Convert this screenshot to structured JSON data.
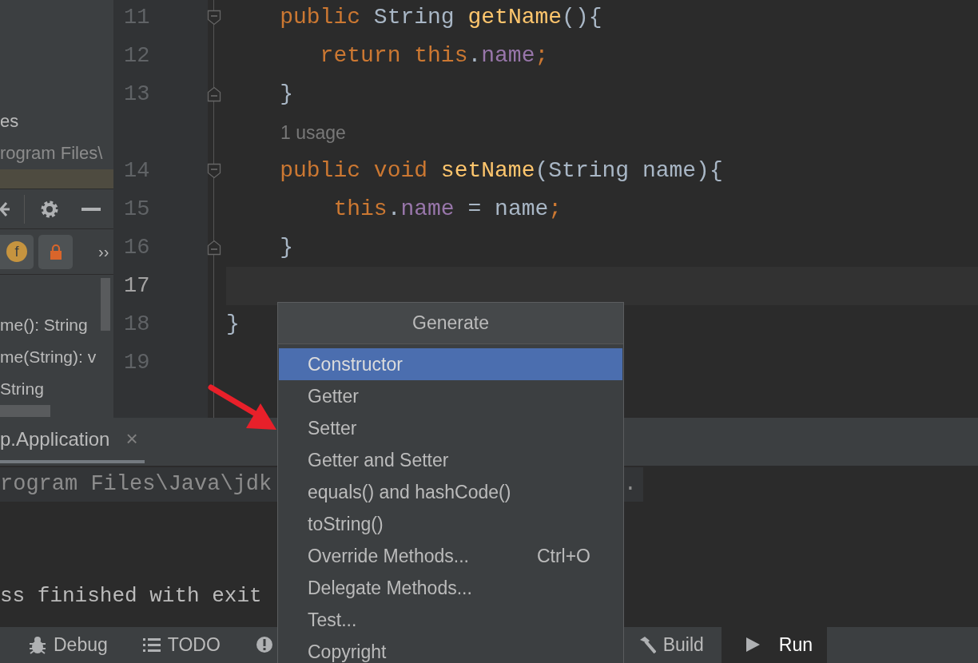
{
  "project_panel": {
    "items": [
      {
        "label": "es",
        "kind": "node",
        "selected": false
      },
      {
        "label": "rogram Files\\",
        "kind": "path",
        "selected": false
      },
      {
        "kind": "node",
        "selected": true
      }
    ]
  },
  "structure_panel": {
    "filters": [
      {
        "badge": "f",
        "kind": "field",
        "selected": true
      },
      {
        "kind": "lock",
        "selected": true
      }
    ],
    "more": "››",
    "items": [
      {
        "label": "me(): String"
      },
      {
        "label": "me(String): v"
      },
      {
        "label": "String"
      }
    ]
  },
  "editor": {
    "lines": [
      {
        "number": "11",
        "fold_start": true,
        "fold_end": false,
        "current": false,
        "tokens": [
          {
            "kind": "keyword",
            "text": "    public "
          },
          {
            "kind": "plain",
            "text": "String "
          },
          {
            "kind": "method",
            "text": "getName"
          },
          {
            "kind": "plain",
            "text": "(){"
          }
        ]
      },
      {
        "number": "12",
        "fold_start": false,
        "fold_end": false,
        "current": false,
        "tokens": [
          {
            "kind": "keyword",
            "text": "       return this"
          },
          {
            "kind": "plain",
            "text": "."
          },
          {
            "kind": "field",
            "text": "name"
          },
          {
            "kind": "keyword",
            "text": ";"
          }
        ]
      },
      {
        "number": "13",
        "fold_start": false,
        "fold_end": true,
        "current": false,
        "tokens": [
          {
            "kind": "plain",
            "text": "    }"
          }
        ]
      },
      {
        "kind": "hint",
        "text": "1 usage"
      },
      {
        "number": "14",
        "fold_start": true,
        "fold_end": false,
        "current": false,
        "tokens": [
          {
            "kind": "keyword",
            "text": "    public void "
          },
          {
            "kind": "method",
            "text": "setName"
          },
          {
            "kind": "plain",
            "text": "(String name){"
          }
        ]
      },
      {
        "number": "15",
        "fold_start": false,
        "fold_end": false,
        "current": false,
        "tokens": [
          {
            "kind": "keyword",
            "text": "        this"
          },
          {
            "kind": "plain",
            "text": "."
          },
          {
            "kind": "field",
            "text": "name"
          },
          {
            "kind": "plain",
            "text": " = name"
          },
          {
            "kind": "keyword",
            "text": ";"
          }
        ]
      },
      {
        "number": "16",
        "fold_start": false,
        "fold_end": true,
        "current": false,
        "tokens": [
          {
            "kind": "plain",
            "text": "    }"
          }
        ]
      },
      {
        "number": "17",
        "fold_start": false,
        "fold_end": false,
        "current": true
      },
      {
        "number": "18",
        "fold_start": false,
        "fold_end": false,
        "current": false,
        "tokens": [
          {
            "kind": "plain",
            "text": "}"
          }
        ]
      },
      {
        "number": "19",
        "fold_start": false,
        "fold_end": false,
        "current": false
      }
    ]
  },
  "run_panel": {
    "tab": {
      "label": "p.Application",
      "selected": true,
      "close": "×"
    },
    "console": [
      {
        "kind": "command",
        "text": "rogram Files\\Java\\jdk",
        "tail": "."
      },
      {
        "kind": "output",
        "text": "ss finished with exit"
      }
    ]
  },
  "tool_bar": [
    {
      "kind": "debug",
      "label": "Debug",
      "selected": false
    },
    {
      "kind": "todo",
      "label": "TODO",
      "selected": false
    },
    {
      "kind": "problems",
      "selected": false
    },
    {
      "kind": "build",
      "label": "Build",
      "selected": false
    },
    {
      "kind": "run",
      "label": "Run",
      "selected": true
    }
  ],
  "popup": {
    "title": "Generate",
    "items": [
      {
        "label": "Constructor",
        "selected": true
      },
      {
        "label": "Getter",
        "selected": false
      },
      {
        "label": "Setter",
        "selected": false
      },
      {
        "label": "Getter and Setter",
        "selected": false
      },
      {
        "label": "equals() and hashCode()",
        "selected": false
      },
      {
        "label": "toString()",
        "selected": false
      },
      {
        "label": "Override Methods...",
        "shortcut": "Ctrl+O",
        "selected": false
      },
      {
        "label": "Delegate Methods...",
        "selected": false
      },
      {
        "label": "Test...",
        "selected": false
      },
      {
        "label": "Copyright",
        "selected": false
      }
    ]
  }
}
